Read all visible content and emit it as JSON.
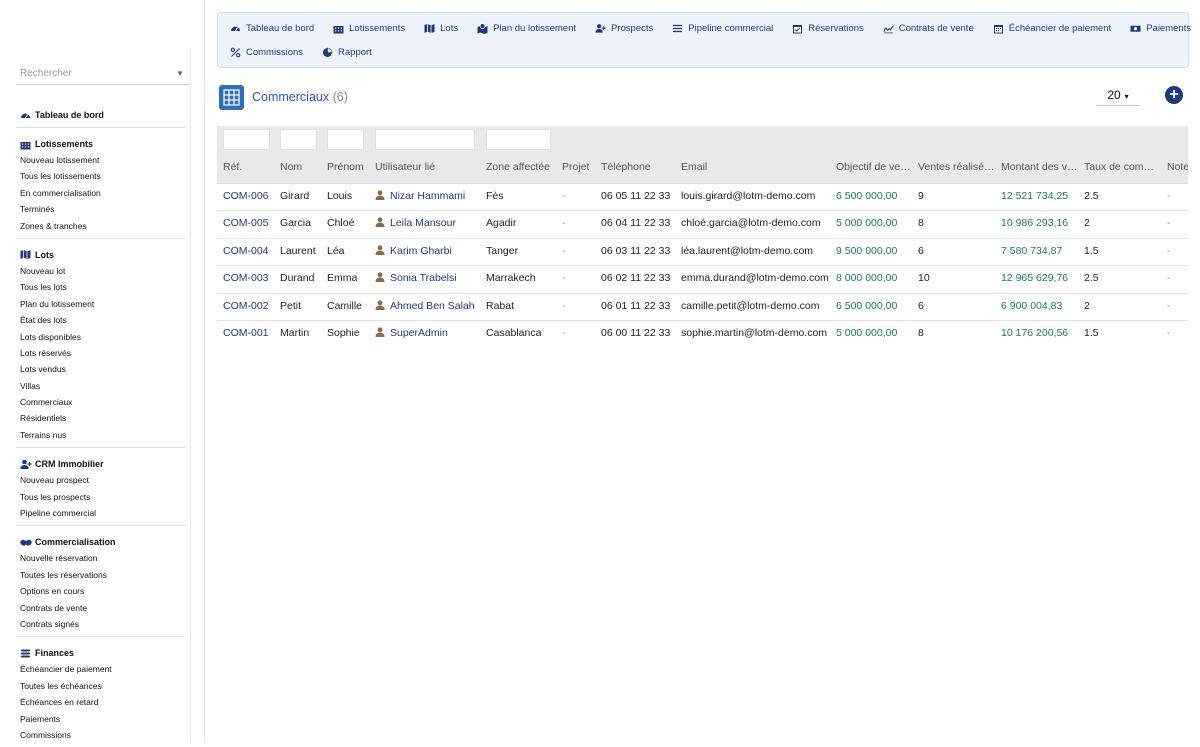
{
  "sidebar": {
    "search_placeholder": "Rechercher",
    "sections": [
      {
        "title": "Tableau de bord",
        "icon": "dashboard-icon",
        "items": []
      },
      {
        "title": "Lotissements",
        "icon": "buildings-icon",
        "items": [
          "Nouveau lotissement",
          "Tous les lotissements",
          "En commercialisation",
          "Terminés",
          "Zones & tranches"
        ]
      },
      {
        "title": "Lots",
        "icon": "map-icon",
        "items": [
          "Nouveau lot",
          "Tous les lots",
          "Plan du lotissement",
          "État des lots",
          "Lots disponibles",
          "Lots réservés",
          "Lots vendus",
          "Villas",
          "Commerciaux",
          "Résidentiels",
          "Terrains nus"
        ]
      },
      {
        "title": "CRM Immobilier",
        "icon": "user-plus-icon",
        "items": [
          "Nouveau prospect",
          "Tous les prospects",
          "Pipeline commercial"
        ]
      },
      {
        "title": "Commercialisation",
        "icon": "handshake-icon",
        "items": [
          "Nouvelle réservation",
          "Toutes les réservations",
          "Options en cours",
          "Contrats de vente",
          "Contrats signés"
        ]
      },
      {
        "title": "Finances",
        "icon": "coins-icon",
        "items": [
          "Échéancier de paiement",
          "Toutes les échéances",
          "Échéances en retard",
          "Paiements",
          "Commissions"
        ]
      }
    ]
  },
  "topnav": {
    "row1": [
      {
        "label": "Tableau de bord",
        "icon": "dashboard-icon"
      },
      {
        "label": "Lotissements",
        "icon": "buildings-icon"
      },
      {
        "label": "Lots",
        "icon": "map-icon"
      },
      {
        "label": "Plan du lotissement",
        "icon": "map-pin-icon"
      },
      {
        "label": "Prospects",
        "icon": "user-plus-icon"
      },
      {
        "label": "Pipeline commercial",
        "icon": "list-icon"
      },
      {
        "label": "Réservations",
        "icon": "calendar-check-icon"
      },
      {
        "label": "Contrats de vente",
        "icon": "signature-icon"
      },
      {
        "label": "Échéancier de paiement",
        "icon": "calendar-icon"
      },
      {
        "label": "Paiements",
        "icon": "money-icon"
      }
    ],
    "row2": [
      {
        "label": "Commissions",
        "icon": "percent-icon"
      },
      {
        "label": "Rapport",
        "icon": "pie-chart-icon"
      }
    ]
  },
  "page": {
    "title": "Commerciaux",
    "count": "(6)",
    "page_size": "20",
    "add_label": "+"
  },
  "table": {
    "columns": [
      "Réf.",
      "Nom",
      "Prénom",
      "Utilisateur lié",
      "Zone affectée",
      "Projet",
      "Téléphone",
      "Email",
      "Objectif de ventes",
      "Ventes réalisées",
      "Montant des ventes",
      "Taux de commission",
      "Notes"
    ],
    "rows": [
      [
        "COM-006",
        "Girard",
        "Louis",
        "Nizar Hammami",
        "Fès",
        "-",
        "06 05 11 22 33",
        "louis.girard@lotm-demo.com",
        "6 500 000,00",
        "9",
        "12 521 734,25",
        "2.5",
        "-"
      ],
      [
        "COM-005",
        "Garcia",
        "Chloé",
        "Leila Mansour",
        "Agadir",
        "-",
        "06 04 11 22 33",
        "chloé.garcia@lotm-demo.com",
        "5 000 000,00",
        "8",
        "10 986 293,16",
        "2",
        "-"
      ],
      [
        "COM-004",
        "Laurent",
        "Léa",
        "Karim Gharbi",
        "Tanger",
        "-",
        "06 03 11 22 33",
        "léa.laurent@lotm-demo.com",
        "9 500 000,00",
        "6",
        "7 580 734,87",
        "1.5",
        "-"
      ],
      [
        "COM-003",
        "Durand",
        "Emma",
        "Sonia Trabelsi",
        "Marrakech",
        "-",
        "06 02 11 22 33",
        "emma.durand@lotm-demo.com",
        "8 000 000,00",
        "10",
        "12 965 629,76",
        "2.5",
        "-"
      ],
      [
        "COM-002",
        "Petit",
        "Camille",
        "Ahmed Ben Salah",
        "Rabat",
        "-",
        "06 01 11 22 33",
        "camille.petit@lotm-demo.com",
        "6 500 000,00",
        "6",
        "6 900 004,83",
        "2",
        "-"
      ],
      [
        "COM-001",
        "Martin",
        "Sophie",
        "SuperAdmin",
        "Casablanca",
        "-",
        "06 00 11 22 33",
        "sophie.martin@lotm-demo.com",
        "5 000 000,00",
        "8",
        "10 176 200,56",
        "1.5",
        "-"
      ]
    ]
  },
  "colors": {
    "accent": "#1f3a7a",
    "money": "#1d7a5f",
    "nav_bg": "#eef3fb"
  }
}
